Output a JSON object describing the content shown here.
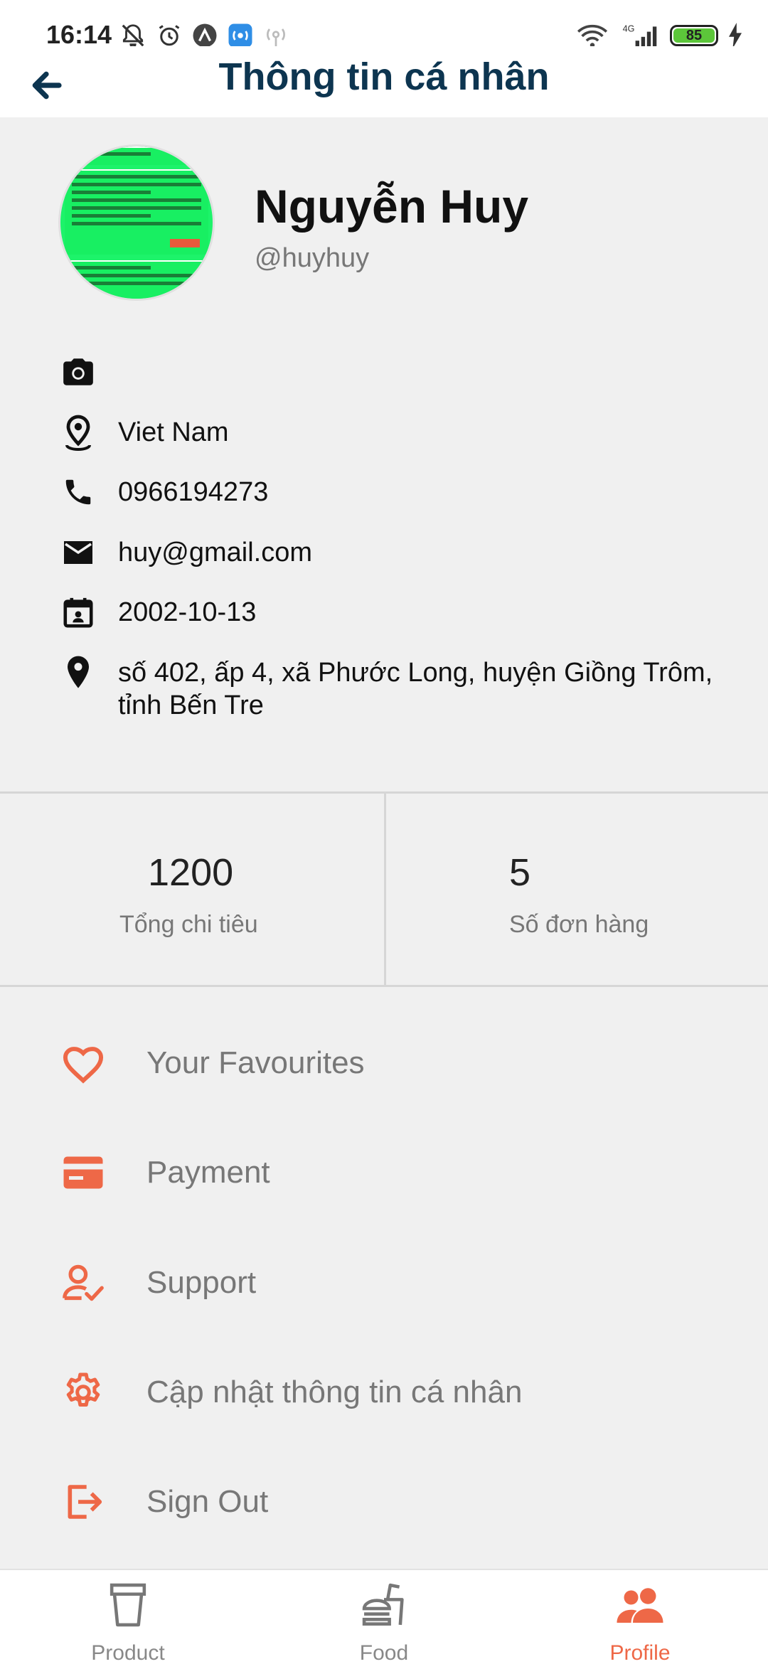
{
  "status_bar": {
    "time": "16:14",
    "network": "4G",
    "battery": "85"
  },
  "header": {
    "title": "Thông tin cá nhân",
    "back_icon": "arrow-left-icon"
  },
  "profile": {
    "name": "Nguyễn Huy",
    "handle": "@huyhuy"
  },
  "info": {
    "country": "Viet Nam",
    "phone": "0966194273",
    "email": "huy@gmail.com",
    "birthday": "2002-10-13",
    "address": "số 402, ấp 4, xã Phước Long, huyện Giồng Trôm, tỉnh Bến Tre"
  },
  "stats": [
    {
      "value": "1200",
      "label": "Tổng chi tiêu"
    },
    {
      "value": "5",
      "label": "Số đơn hàng"
    }
  ],
  "menu": [
    {
      "label": "Your Favourites",
      "icon": "heart-icon"
    },
    {
      "label": "Payment",
      "icon": "credit-card-icon"
    },
    {
      "label": "Support",
      "icon": "user-check-icon"
    },
    {
      "label": "Cập nhật thông tin cá nhân",
      "icon": "gear-icon"
    },
    {
      "label": "Sign Out",
      "icon": "sign-out-icon"
    }
  ],
  "tabs": [
    {
      "label": "Product",
      "icon": "cup-icon",
      "active": false
    },
    {
      "label": "Food",
      "icon": "burger-drink-icon",
      "active": false
    },
    {
      "label": "Profile",
      "icon": "users-icon",
      "active": true
    }
  ],
  "colors": {
    "accent": "#ee6847",
    "title": "#0d3550",
    "background": "#f0f0f0",
    "avatar_green": "#1df36a"
  }
}
